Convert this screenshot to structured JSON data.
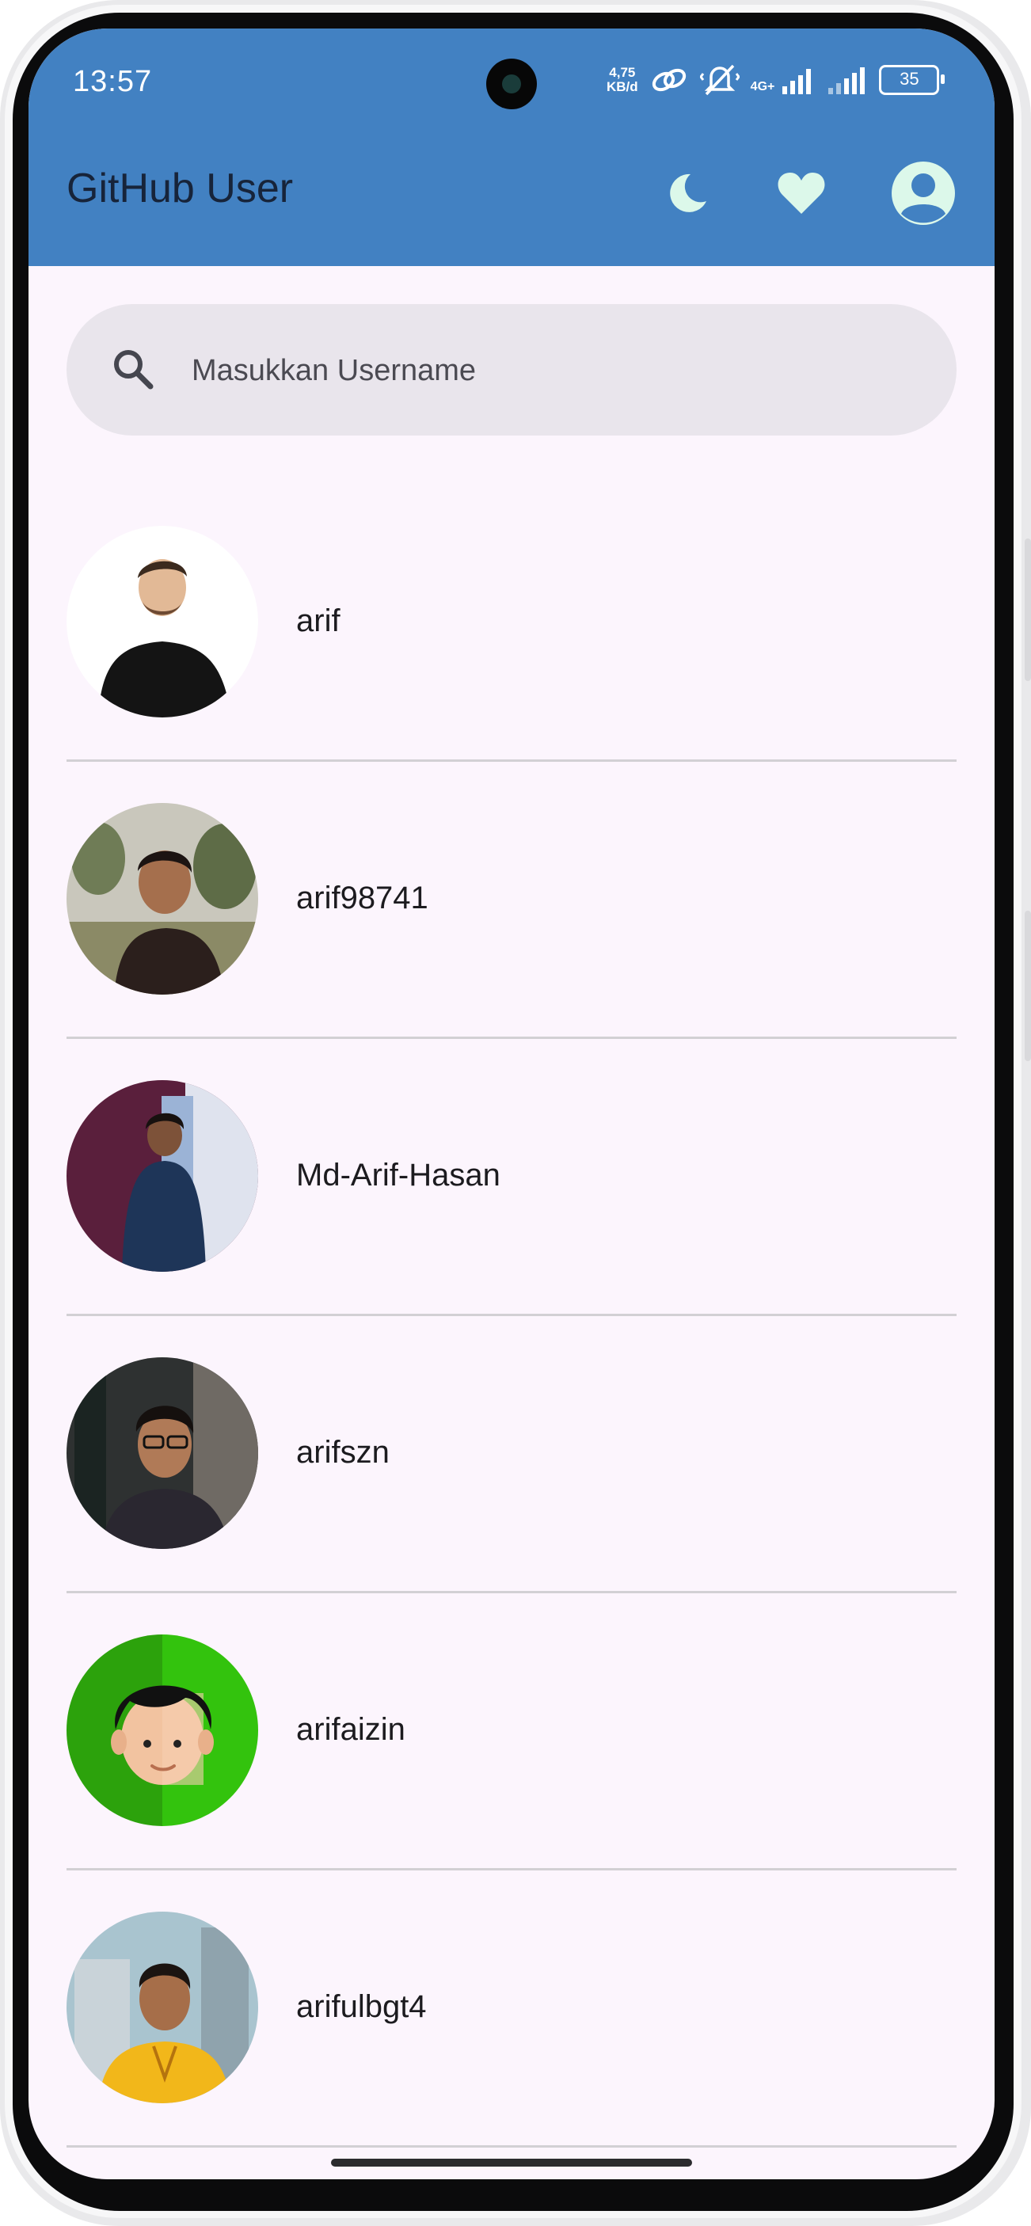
{
  "status_bar": {
    "time": "13:57",
    "net_speed_value": "4,75",
    "net_speed_unit": "KB/d",
    "network_type": "4G+",
    "battery": "35"
  },
  "app_bar": {
    "title": "GitHub User",
    "background_color": "#4281c2",
    "icon_color": "#dcf8ea",
    "icons": [
      "moon-icon",
      "heart-icon",
      "account-circle-icon"
    ]
  },
  "search": {
    "placeholder": "Masukkan Username",
    "value": ""
  },
  "users": [
    {
      "login": "arif"
    },
    {
      "login": "arif98741"
    },
    {
      "login": "Md-Arif-Hasan"
    },
    {
      "login": "arifszn"
    },
    {
      "login": "arifaizin"
    },
    {
      "login": "arifulbgt4"
    }
  ]
}
